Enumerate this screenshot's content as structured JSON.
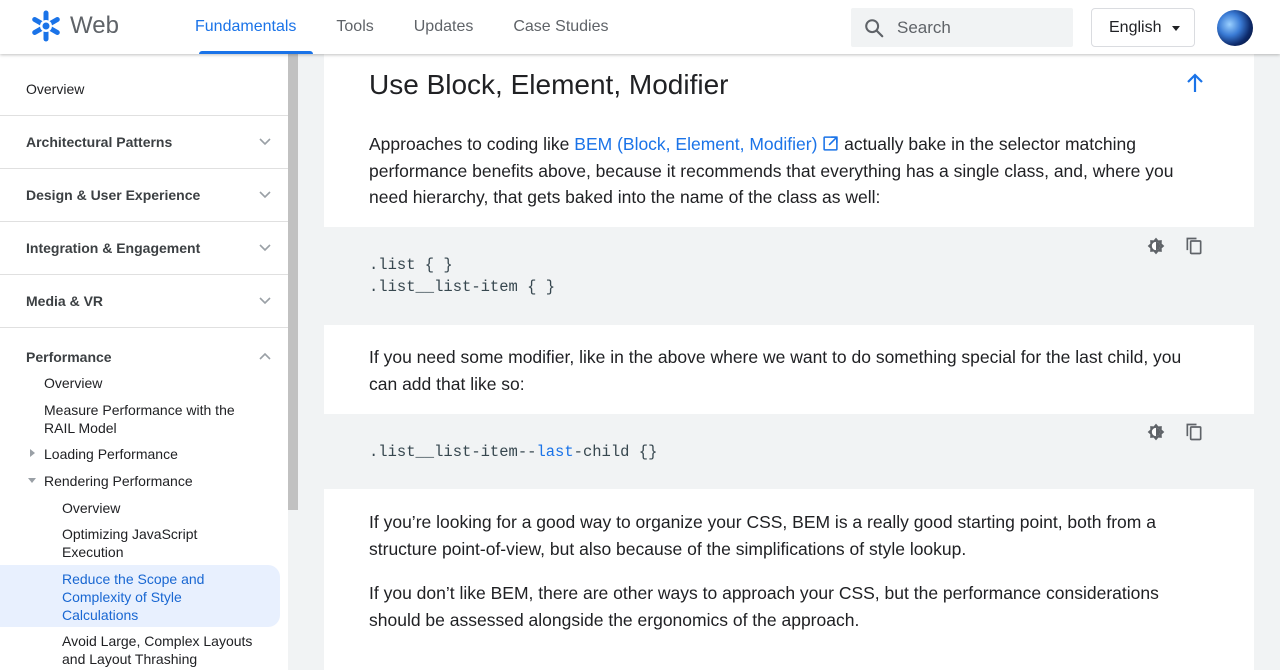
{
  "header": {
    "logo_text": "Web",
    "nav": [
      "Fundamentals",
      "Tools",
      "Updates",
      "Case Studies"
    ],
    "search_placeholder": "Search",
    "language": "English"
  },
  "sidebar": {
    "overview": "Overview",
    "sections": [
      "Architectural Patterns",
      "Design & User Experience",
      "Integration & Engagement",
      "Media & VR"
    ],
    "performance": "Performance",
    "perf_items": {
      "overview": "Overview",
      "rail_1": "Measure Performance with the",
      "rail_2": "RAIL Model",
      "loading": "Loading Performance",
      "rendering": "Rendering Performance"
    },
    "rendering_items": {
      "overview": "Overview",
      "js_1": "Optimizing JavaScript",
      "js_2": "Execution",
      "scope_1": "Reduce the Scope and",
      "scope_2": "Complexity of Style",
      "scope_3": "Calculations",
      "layout_1": "Avoid Large, Complex Layouts",
      "layout_2": "and Layout Thrashing"
    }
  },
  "main": {
    "heading": "Use Block, Element, Modifier",
    "p1": {
      "pre": "Approaches to coding like ",
      "link": "BEM (Block, Element, Modifier)",
      "post_1": " actually bake in the selector matching",
      "line_2": "performance benefits above, because it recommends that everything has a single class, and, where you",
      "line_3": "need hierarchy, that gets baked into the name of the class as well:"
    },
    "code1": [
      ".list { }",
      ".list__list-item { }"
    ],
    "p2": {
      "line_1": "If you need some modifier, like in the above where we want to do something special for the last child, you",
      "line_2": "can add that like so:"
    },
    "code2": {
      "pre": ".list__list-item--",
      "kw": "last",
      "post": "-child {}"
    },
    "p3": {
      "line_1": "If you’re looking for a good way to organize your CSS, BEM is a really good starting point, both from a",
      "line_2": "structure point-of-view, but also because of the simplifications of style lookup."
    },
    "p4": {
      "line_1": "If you don’t like BEM, there are other ways to approach your CSS, but the performance considerations",
      "line_2": "should be assessed alongside the ergonomics of the approach."
    }
  }
}
